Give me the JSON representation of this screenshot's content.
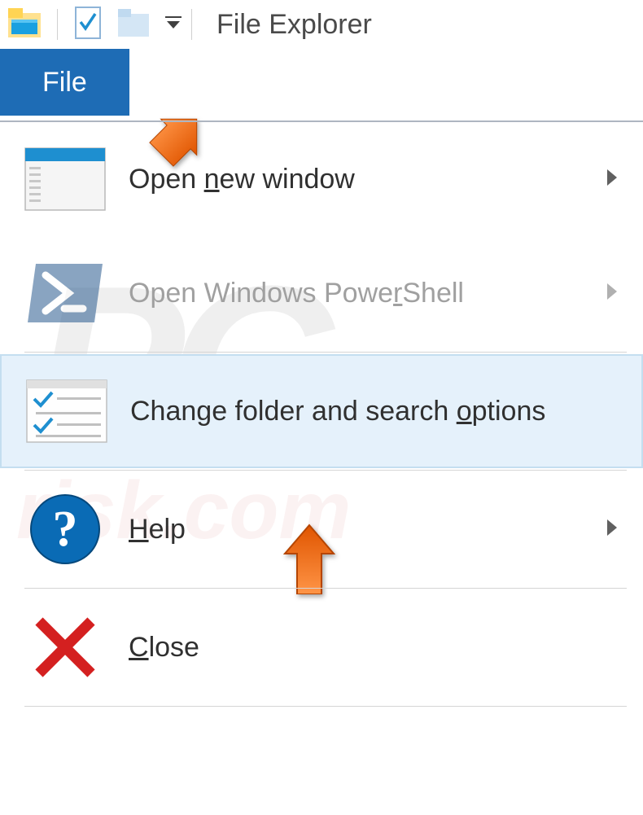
{
  "window": {
    "title": "File Explorer"
  },
  "ribbon": {
    "active_tab": "File"
  },
  "menu": {
    "items": [
      {
        "label_pre": "Open ",
        "label_u": "n",
        "label_post": "ew window",
        "hasSubmenu": true,
        "disabled": false
      },
      {
        "label_pre": "Open Windows Powe",
        "label_u": "r",
        "label_post": "Shell",
        "hasSubmenu": true,
        "disabled": true
      },
      {
        "label_pre": "Change folder and search ",
        "label_u": "o",
        "label_post": "ptions",
        "hasSubmenu": false,
        "disabled": false
      },
      {
        "label_pre": "",
        "label_u": "H",
        "label_post": "elp",
        "hasSubmenu": true,
        "disabled": false
      },
      {
        "label_pre": "",
        "label_u": "C",
        "label_post": "lose",
        "hasSubmenu": false,
        "disabled": false
      }
    ]
  },
  "watermark": {
    "line1": "PC",
    "line2": "risk.com"
  }
}
